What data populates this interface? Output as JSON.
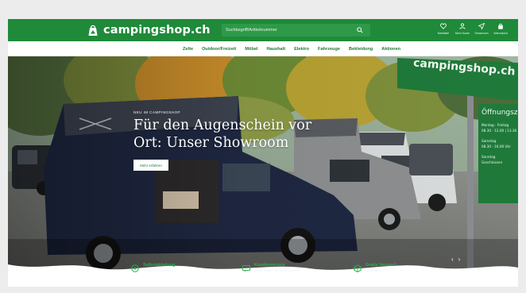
{
  "header": {
    "logo_text": "campingshop.ch",
    "search_placeholder": "Suchbegriff/Artikelnummer",
    "actions": [
      {
        "label": "Merkliste",
        "icon": "heart-icon"
      },
      {
        "label": "Mein Konto",
        "icon": "user-icon"
      },
      {
        "label": "Showroom",
        "icon": "location-arrow-icon"
      },
      {
        "label": "Warenkorb",
        "icon": "shopping-bag-icon"
      }
    ]
  },
  "nav": {
    "items": [
      "Zelte",
      "Outdoor/Freizeit",
      "Möbel",
      "Haushalt",
      "Elektro",
      "Fahrzeuge",
      "Bekleidung",
      "Aktionen"
    ]
  },
  "hero": {
    "eyebrow": "NEU IM CAMPINGSHOP",
    "headline": "Für den Augenschein vor Ort: Unser Showroom",
    "cta_label": "Mehr erfahren",
    "sign_brand": "campingshop.ch",
    "hours": {
      "title": "Öffnungsz",
      "line1": "Montag - Freitag",
      "line2": "08.30 - 12.00 | 13.30",
      "line3": "Samstag",
      "line4": "08.30 - 16.00 Uhr",
      "line5": "Sonntag",
      "line6": "Geschlossen"
    },
    "pager_prev": "‹",
    "pager_next": "›"
  },
  "usps": [
    {
      "title": "Selbstabholung",
      "subtitle": "in unserem Showroom",
      "icon": "location-pin-icon"
    },
    {
      "title": "Kundenservice",
      "subtitle": "Gerne beraten wir Sie in unserem",
      "icon": "chat-icon"
    },
    {
      "title": "Gratis Versand",
      "subtitle": "Schon ab CHF 50.-",
      "icon": "package-icon"
    }
  ],
  "colors": {
    "brand_green": "#1f8a3a",
    "nav_text": "#1e7a36",
    "usp_green": "#26b24a"
  }
}
